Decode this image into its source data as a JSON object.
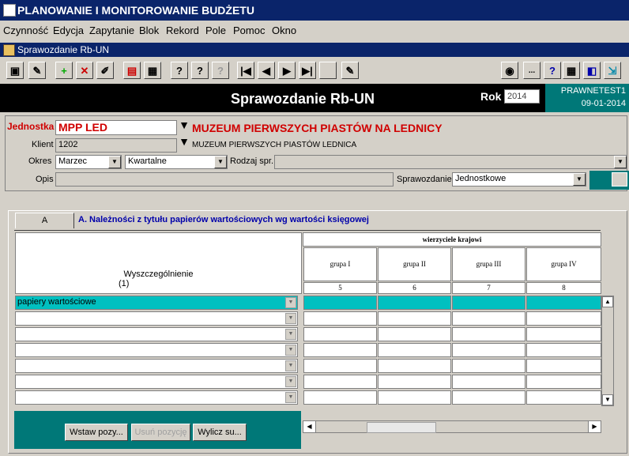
{
  "app": {
    "title": "PLANOWANIE I MONITOROWANIE BUDŻETU"
  },
  "menu": [
    "Czynność",
    "Edycja",
    "Zapytanie",
    "Blok",
    "Rekord",
    "Pole",
    "Pomoc",
    "Okno"
  ],
  "window": {
    "title": "Sprawozdanie Rb-UN"
  },
  "toolbar": {
    "icons": [
      "save-icon",
      "edit-icon",
      "add-icon",
      "delete-icon",
      "tools-icon",
      "form-icon",
      "grid-icon",
      "search-icon",
      "query-icon",
      "help-query-icon",
      "first-record-icon",
      "prev-record-icon",
      "next-record-icon",
      "last-record-icon",
      "blank-icon",
      "note-icon",
      "print-icon",
      "more-icon",
      "help-icon",
      "calculator-icon",
      "window-icon",
      "exit-icon"
    ],
    "more_label": "...",
    "help_label": "?"
  },
  "header": {
    "title": "Sprawozdanie Rb-UN",
    "rok_label": "Rok",
    "rok_value": "2014",
    "user": "PRAWNETEST1",
    "date": "09-01-2014"
  },
  "form": {
    "jednostka_label": "Jednostka",
    "jednostka_value": "MPP LED",
    "jednostka_name": "MUZEUM PIERWSZYCH PIASTÓW NA LEDNICY",
    "klient_label": "Klient",
    "klient_value": "1202",
    "klient_name": "MUZEUM PIERWSZYCH PIASTÓW LEDNICA",
    "okres_label": "Okres",
    "okres_value": "Marzec",
    "okres_type": "Kwartalne",
    "rodzaj_label": "Rodzaj spr.",
    "rodzaj_value": "",
    "opis_label": "Opis",
    "opis_value": "",
    "sprawozdanie_label": "Sprawozdanie",
    "sprawozdanie_value": "Jednostkowe"
  },
  "tab": {
    "label": "A",
    "title": "A. Należności z tytułu papierów wartościowych wg wartości księgowej"
  },
  "table": {
    "group_header": "wierzyciele krajowi",
    "desc_header": "Wyszczególnienie",
    "desc_num": "(1)",
    "columns": [
      {
        "label": "grupa I",
        "num": "5"
      },
      {
        "label": "grupa II",
        "num": "6"
      },
      {
        "label": "grupa III",
        "num": "7"
      },
      {
        "label": "grupa IV",
        "num": "8"
      }
    ],
    "rows": [
      "papiery wartościowe",
      "",
      "",
      "",
      "",
      "",
      ""
    ]
  },
  "buttons": {
    "insert": "Wstaw pozy...",
    "delete": "Usuń pozycję",
    "compute": "Wylicz su..."
  },
  "colors": {
    "teal": "#007878",
    "selection": "#00c0c0",
    "titlebar": "#0a246a",
    "red": "#d00000"
  }
}
